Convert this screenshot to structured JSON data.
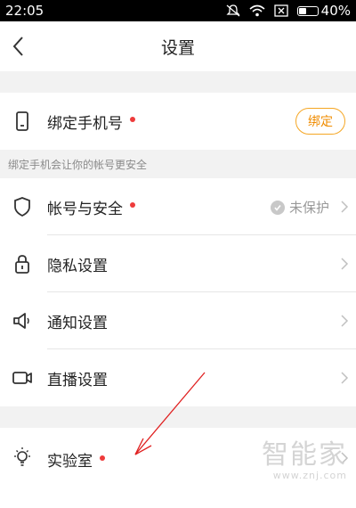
{
  "status_bar": {
    "time": "22:05",
    "battery": "40%"
  },
  "header": {
    "title": "设置"
  },
  "bind_phone": {
    "label": "绑定手机号",
    "button": "绑定",
    "note": "绑定手机会让你的帐号更安全"
  },
  "menu": [
    {
      "label": "帐号与安全",
      "status": "未保护"
    },
    {
      "label": "隐私设置"
    },
    {
      "label": "通知设置"
    },
    {
      "label": "直播设置"
    }
  ],
  "lab": {
    "label": "实验室"
  },
  "watermark": {
    "title": "智能家",
    "url": "www.znj.com"
  },
  "colors": {
    "accent": "#f5a623",
    "dot": "#ee3b3b",
    "arrow": "#e02020"
  }
}
